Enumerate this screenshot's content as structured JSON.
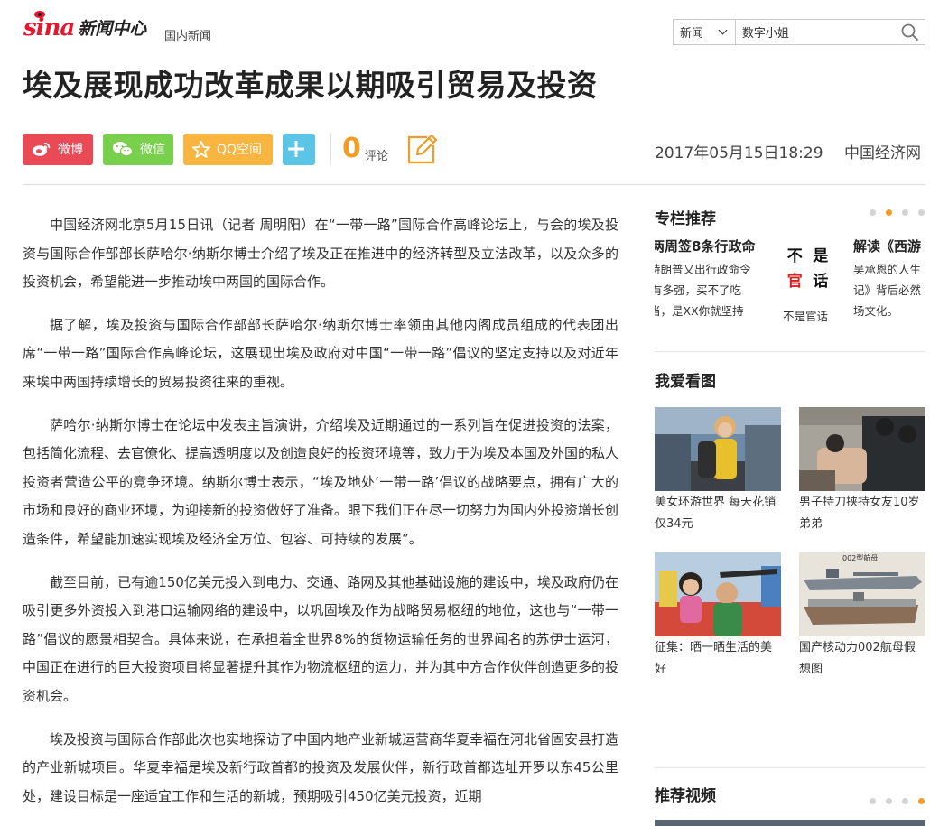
{
  "header": {
    "logo_brand": "sina",
    "logo_section": "新闻中心",
    "channel": "国内新闻",
    "search": {
      "category": "新闻",
      "query": "数字小姐"
    }
  },
  "article": {
    "title": "埃及展现成功改革成果以期吸引贸易及投资",
    "datetime": "2017年05月15日18:29",
    "source": "中国经济网",
    "comment_count": "0",
    "comment_label": "评论",
    "paragraphs": [
      "中国经济网北京5月15日讯（记者 周明阳）在“一带一路”国际合作高峰论坛上，与会的埃及投资与国际合作部部长萨哈尔·纳斯尔博士介绍了埃及正在推进中的经济转型及立法改革，以及众多的投资机会，希望能进一步推动埃中两国的国际合作。",
      "据了解，埃及投资与国际合作部部长萨哈尔·纳斯尔博士率领由其他内阁成员组成的代表团出席“一带一路”国际合作高峰论坛，这展现出埃及政府对中国“一带一路”倡议的坚定支持以及对近年来埃中两国持续增长的贸易投资往来的重视。",
      "萨哈尔·纳斯尔博士在论坛中发表主旨演讲，介绍埃及近期通过的一系列旨在促进投资的法案，包括简化流程、去官僚化、提高透明度以及创造良好的投资环境等，致力于为埃及本国及外国的私人投资者营造公平的竞争环境。纳斯尔博士表示，“埃及地处‘一带一路’倡议的战略要点，拥有广大的市场和良好的商业环境，为迎接新的投资做好了准备。眼下我们正在尽一切努力为国内外投资增长创造条件，希望能加速实现埃及经济全方位、包容、可持续的发展”。",
      "截至目前，已有逾150亿美元投入到电力、交通、路网及其他基础设施的建设中，埃及政府仍在吸引更多外资投入到港口运输网络的建设中，以巩固埃及作为战略贸易枢纽的地位，这也与“一带一路”倡议的愿景相契合。具体来说，在承担着全世界8%的货物运输任务的世界闻名的苏伊士运河，中国正在进行的巨大投资项目将显著提升其作为物流枢纽的运力，并为其中方合作伙伴创造更多的投资机会。",
      "埃及投资与国际合作部此次也实地探访了中国内地产业新城运营商华夏幸福在河北省固安县打造的产业新城项目。华夏幸福是埃及新行政首都的投资及发展伙伴，新行政首都选址开罗以东45公里处，建设目标是一座适宜工作和生活的新城，预期吸引450亿美元投资，近期"
    ]
  },
  "share": {
    "weibo": "微博",
    "weixin": "微信",
    "qzone": "QQ空间"
  },
  "sidebar": {
    "column": {
      "title": "专栏推荐",
      "item1": {
        "headline": "两周签8条行政命",
        "lines": [
          "特朗普又出行政命令",
          "有多强，买不了吃",
          "当，是XX你就坚持"
        ]
      },
      "item2": {
        "seal_chars": [
          "不",
          "是",
          "官",
          "话"
        ],
        "caption": "不是官话"
      },
      "item3": {
        "headline": "解读《西游",
        "lines": [
          "吴承恩的人生",
          "记》背后必然",
          "场文化。"
        ]
      }
    },
    "pictures": {
      "title": "我爱看图",
      "items": [
        {
          "caption": "美女环游世界 每天花销仅34元"
        },
        {
          "caption": "男子持刀挟持女友10岁弟弟"
        },
        {
          "caption": "征集：晒一晒生活的美好"
        },
        {
          "caption": "国产核动力002航母假想图",
          "image_text": "002型航母"
        }
      ]
    },
    "video": {
      "title": "推荐视频"
    }
  }
}
